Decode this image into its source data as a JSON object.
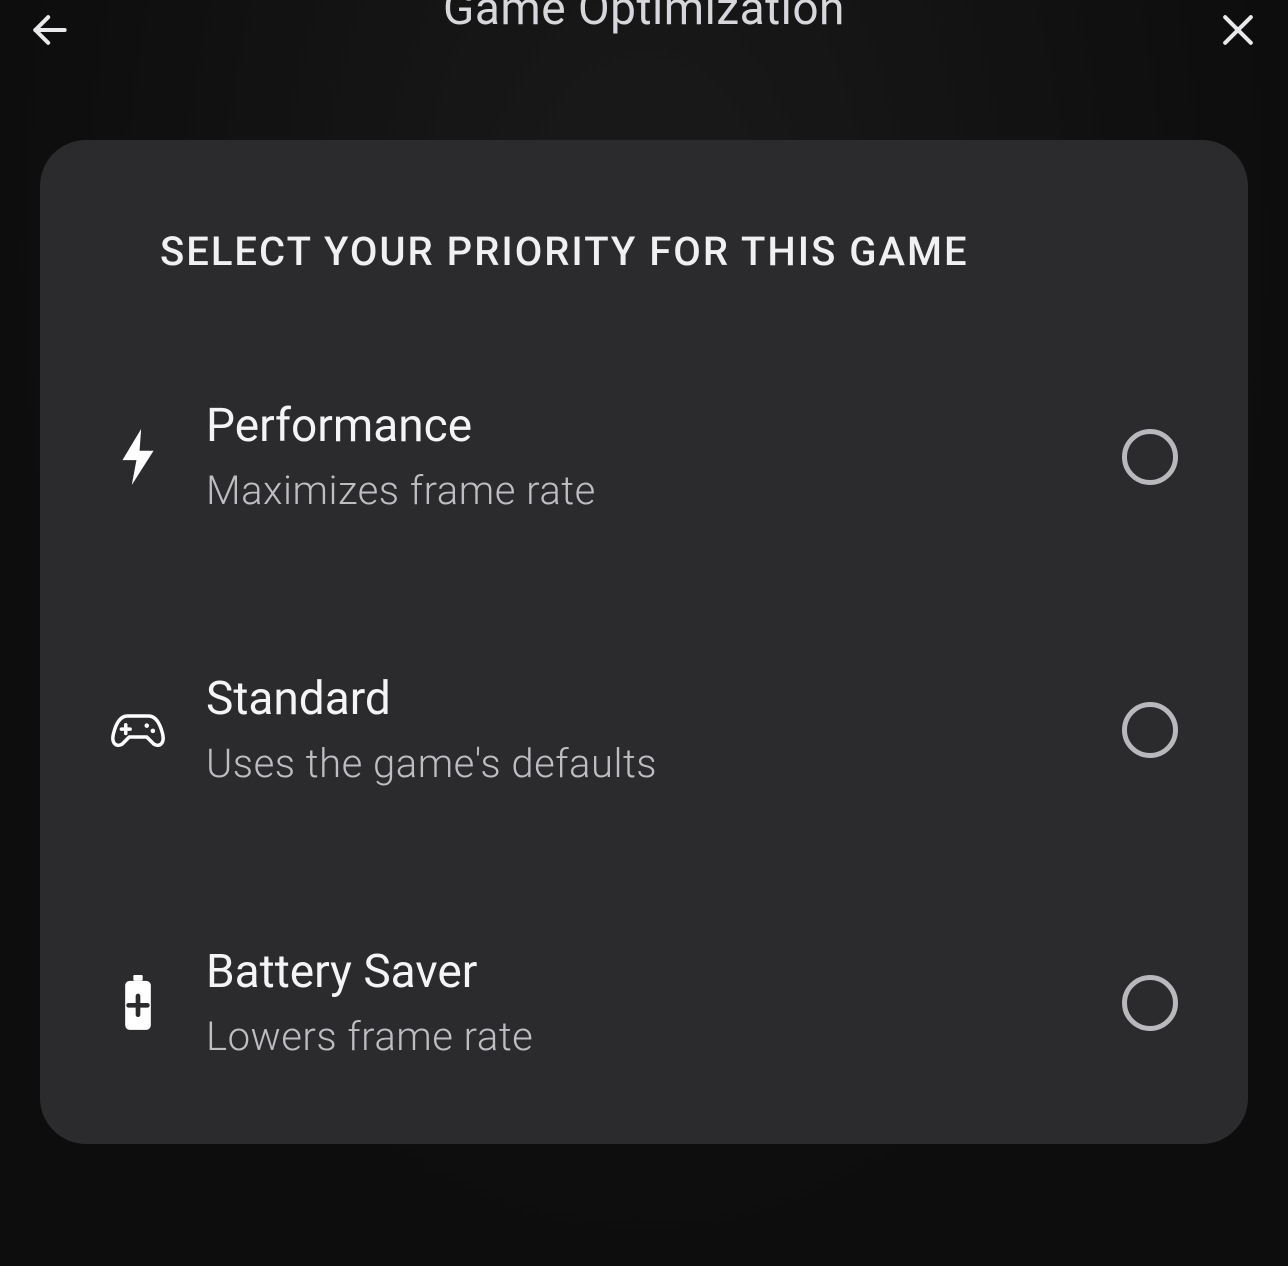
{
  "header": {
    "title": "Game Optimization"
  },
  "card": {
    "heading": "SELECT YOUR PRIORITY FOR THIS GAME",
    "options": [
      {
        "icon": "bolt-icon",
        "title": "Performance",
        "subtitle": "Maximizes frame rate",
        "selected": false
      },
      {
        "icon": "gamepad-icon",
        "title": "Standard",
        "subtitle": "Uses the game's defaults",
        "selected": false
      },
      {
        "icon": "battery-plus-icon",
        "title": "Battery Saver",
        "subtitle": "Lowers frame rate",
        "selected": false
      }
    ]
  }
}
